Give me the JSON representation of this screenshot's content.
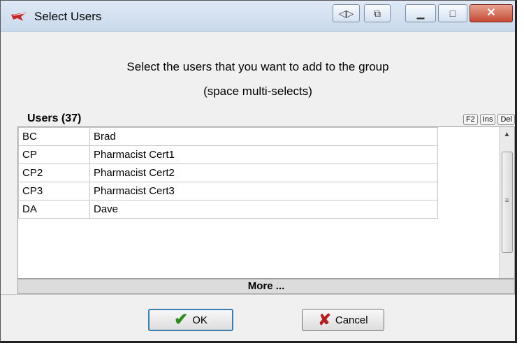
{
  "window": {
    "title": "Select Users"
  },
  "prompt": {
    "line1": "Select the users that you want to add to the group",
    "line2": "(space multi-selects)"
  },
  "users": {
    "header": "Users (37)",
    "shortcut_buttons": [
      "F2",
      "Ins",
      "Del"
    ],
    "rows": [
      {
        "code": "BC",
        "name": "Brad"
      },
      {
        "code": "CP",
        "name": "Pharmacist Cert1"
      },
      {
        "code": "CP2",
        "name": "Pharmacist Cert2"
      },
      {
        "code": "CP3",
        "name": "Pharmacist Cert3"
      },
      {
        "code": "DA",
        "name": "Dave"
      }
    ]
  },
  "more_label": "More ...",
  "buttons": {
    "ok": "OK",
    "cancel": "Cancel"
  },
  "icons": {
    "app": "red-bird-icon",
    "restore": "resize-arrows-icon",
    "copy": "copy-icon",
    "minimize": "minimize-icon",
    "maximize": "maximize-icon",
    "close": "close-icon",
    "ok": "checkmark-icon",
    "cancel": "x-icon"
  },
  "colors": {
    "close_button": "#c54b35",
    "ok_check": "#2d8b1e",
    "cancel_x": "#b32020",
    "ok_focus_border": "#3c7fb1"
  }
}
